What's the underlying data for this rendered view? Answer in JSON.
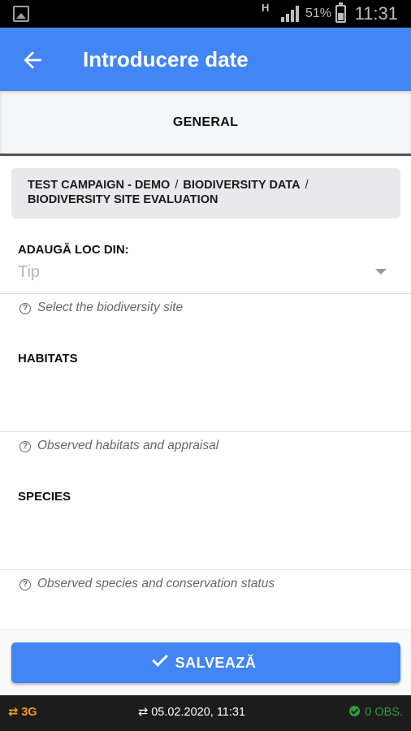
{
  "status_bar": {
    "network_type": "H",
    "battery_percent": "51%",
    "time": "11:31"
  },
  "app_bar": {
    "title": "Introducere date",
    "back_icon": "arrow-back-icon"
  },
  "tabs": [
    {
      "label": "GENERAL",
      "active": true
    }
  ],
  "breadcrumb": {
    "items": [
      "TEST CAMPAIGN - DEMO",
      "BIODIVERSITY DATA",
      "BIODIVERSITY SITE EVALUATION"
    ],
    "separator": "/"
  },
  "form": {
    "site": {
      "label": "ADAUGĂ LOC DIN:",
      "placeholder": "Tip",
      "hint": "Select the biodiversity site"
    },
    "habitats": {
      "label": "HABITATS",
      "hint": "Observed habitats and appraisal"
    },
    "species": {
      "label": "SPECIES",
      "hint": "Observed species and conservation status"
    }
  },
  "save_button": {
    "label": "SALVEAZĂ",
    "icon": "check-icon"
  },
  "bottom_bar": {
    "connection": "3G",
    "sync_time": "05.02.2020, 11:31",
    "observations": "0 OBS."
  },
  "colors": {
    "primary": "#4285f4",
    "connection": "#f29b1d",
    "observations": "#2e9e3d"
  }
}
